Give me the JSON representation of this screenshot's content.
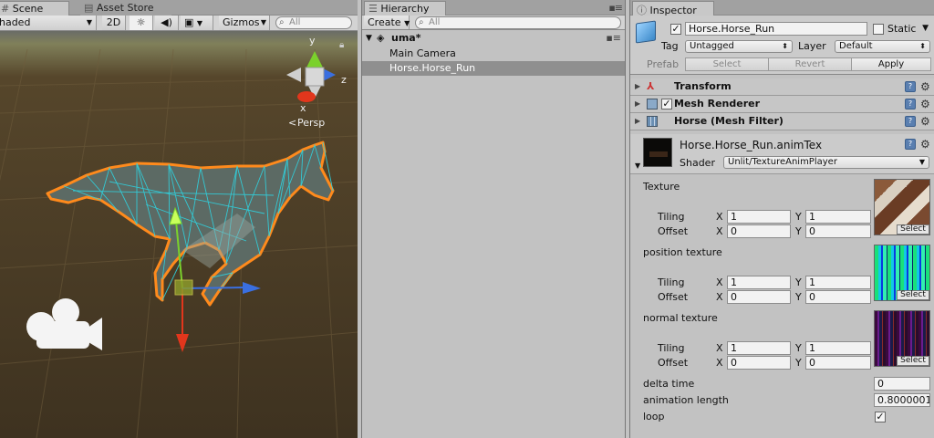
{
  "scene": {
    "tabs": [
      {
        "label": "Scene",
        "active": true,
        "icon": "hash-icon"
      },
      {
        "label": "Asset Store",
        "active": false,
        "icon": "store-icon"
      }
    ],
    "toolbar": {
      "shading_mode": "Shaded",
      "mode_2d_label": "2D",
      "lighting_icon": "sun-icon",
      "audio_icon": "speaker-icon",
      "effects_icon": "image-icon",
      "gizmos_label": "Gizmos",
      "search_placeholder": "All"
    },
    "gizmo": {
      "y_label": "y",
      "z_label": "z",
      "x_label": "x",
      "projection_label": "Persp"
    },
    "colors": {
      "selection_outline": "#ff8a1c",
      "wireframe": "#2fd3e0",
      "axis_x": "#e2361c",
      "axis_y": "#7bd12c",
      "axis_z": "#3a6fe0"
    }
  },
  "hierarchy": {
    "tab_label": "Hierarchy",
    "create_label": "Create",
    "search_placeholder": "All",
    "scene_name": "uma*",
    "items": [
      {
        "label": "Main Camera",
        "selected": false
      },
      {
        "label": "Horse.Horse_Run",
        "selected": true
      }
    ]
  },
  "inspector": {
    "tab_label": "Inspector",
    "object_name": "Horse.Horse_Run",
    "active": true,
    "static_label": "Static",
    "static_checked": false,
    "tag_label": "Tag",
    "tag_value": "Untagged",
    "layer_label": "Layer",
    "layer_value": "Default",
    "prefab_label": "Prefab",
    "prefab_buttons": [
      "Select",
      "Revert",
      "Apply"
    ],
    "components": [
      {
        "name": "Transform",
        "has_checkbox": false,
        "icon": "transform-icon"
      },
      {
        "name": "Mesh Renderer",
        "has_checkbox": true,
        "checked": true,
        "icon": "mesh-renderer-icon"
      },
      {
        "name": "Horse (Mesh Filter)",
        "has_checkbox": false,
        "icon": "mesh-filter-icon"
      }
    ],
    "material": {
      "name": "Horse.Horse_Run.animTex",
      "shader_label": "Shader",
      "shader_value": "Unlit/TextureAnimPlayer",
      "textures": [
        {
          "name": "Texture",
          "tiling_x": "1",
          "tiling_y": "1",
          "offset_x": "0",
          "offset_y": "0",
          "thumb": "horse-skin"
        },
        {
          "name": "position texture",
          "tiling_x": "1",
          "tiling_y": "1",
          "offset_x": "0",
          "offset_y": "0",
          "thumb": "position-bars"
        },
        {
          "name": "normal texture",
          "tiling_x": "1",
          "tiling_y": "1",
          "offset_x": "0",
          "offset_y": "0",
          "thumb": "normal-bars"
        }
      ],
      "tiling_label": "Tiling",
      "offset_label": "Offset",
      "x_label": "X",
      "y_label": "Y",
      "select_label": "Select",
      "delta_time_label": "delta time",
      "delta_time_value": "0",
      "anim_length_label": "animation length",
      "anim_length_value": "0.8000001",
      "loop_label": "loop",
      "loop_checked": true
    }
  }
}
